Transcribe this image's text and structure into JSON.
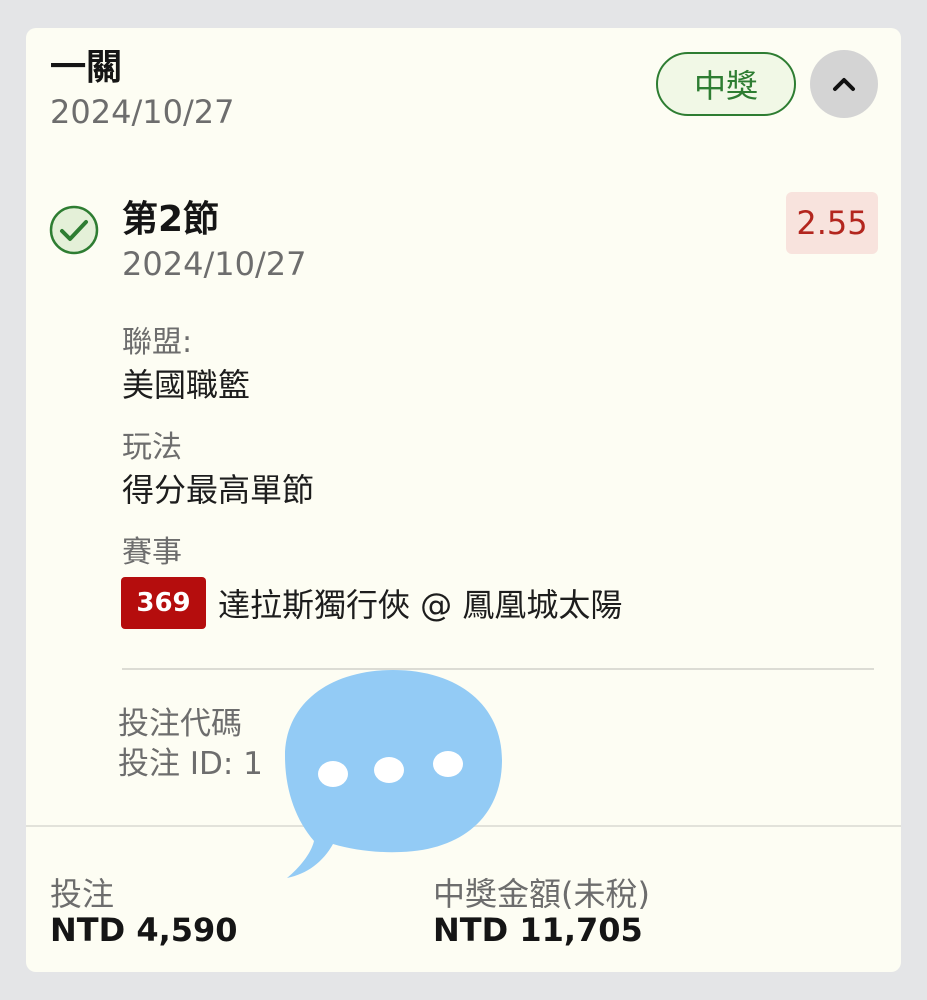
{
  "bet": {
    "type": "一關",
    "date": "2024/10/27",
    "status": "中獎"
  },
  "leg": {
    "title": "第2節",
    "date": "2024/10/27",
    "odds": "2.55",
    "league_label": "聯盟:",
    "league_value": "美國職籃",
    "market_label": "玩法",
    "market_value": "得分最高單節",
    "event_label": "賽事",
    "event_code": "369",
    "event_name": "達拉斯獨行俠 @ 鳳凰城太陽"
  },
  "bet_code": {
    "code_label": "投注代碼",
    "id_label": "投注 ID: 1"
  },
  "summary": {
    "stake_label": "投注",
    "stake_value": "NTD 4,590",
    "payout_label": "中獎金額(未稅)",
    "payout_value": "NTD 11,705"
  },
  "icons": {
    "check": "check-circle-icon",
    "collapse": "chevron-up-icon",
    "overlay": "chat-bubble-icon"
  },
  "colors": {
    "win_green": "#2e7d32",
    "odds_red": "#b3261e",
    "event_code_red": "#b50d0d",
    "card_bg": "#fdfdf3",
    "overlay_blue": "#93cbf5"
  }
}
